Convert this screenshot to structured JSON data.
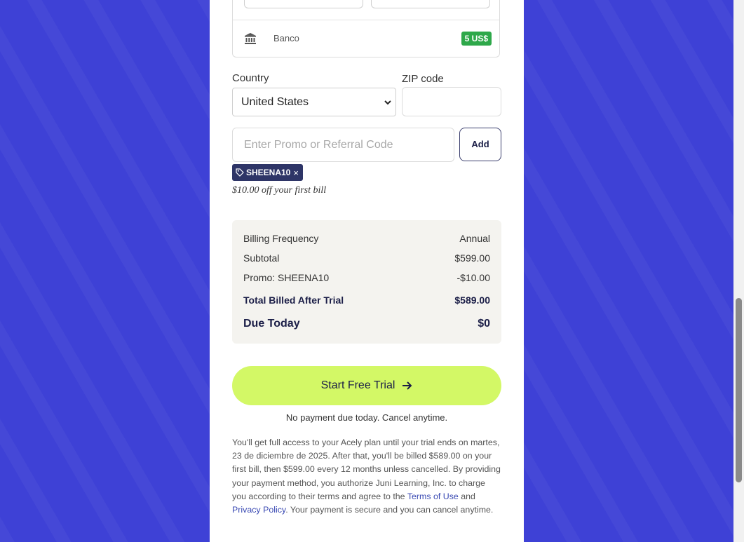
{
  "payment_methods": {
    "bank": {
      "icon": "bank-icon",
      "label": "Banco",
      "badge": "5 US$",
      "badge_color": "#2ea84a"
    }
  },
  "address": {
    "country_label": "Country",
    "country_value": "United States",
    "zip_label": "ZIP code",
    "zip_value": ""
  },
  "promo": {
    "placeholder": "Enter Promo or Referral Code",
    "add_label": "Add",
    "applied_code": "SHEENA10",
    "remove_glyph": "×",
    "note": "$10.00 off your first bill"
  },
  "summary": {
    "rows": [
      {
        "label": "Billing Frequency",
        "value": "Annual"
      },
      {
        "label": "Subtotal",
        "value": "$599.00"
      },
      {
        "label": "Promo: SHEENA10",
        "value": "-$10.00"
      },
      {
        "label": "Total Billed After Trial",
        "value": "$589.00"
      },
      {
        "label": "Due Today",
        "value": "$0"
      }
    ]
  },
  "cta": {
    "label": "Start Free Trial",
    "icon": "arrow-right-icon",
    "color": "#d3f866",
    "sub_text": "No payment due today. Cancel anytime."
  },
  "legal": {
    "text_1": "You'll get full access to your Acely plan until your trial ends on martes, 23 de diciembre de 2025. After that, you'll be billed $589.00 on your first bill, then $599.00 every 12 months unless cancelled. By providing your payment method, you authorize Juni Learning, Inc. to charge you according to their terms and agree to the ",
    "terms_link": "Terms of Use",
    "text_2": " and ",
    "privacy_link": "Privacy Policy",
    "text_3": ". Your payment is secure and you can cancel anytime."
  },
  "colors": {
    "background": "#3e41d6",
    "panel": "#ffffff",
    "navy": "#1b1e47",
    "tag": "#2e3567",
    "link": "#3a4ab3"
  }
}
